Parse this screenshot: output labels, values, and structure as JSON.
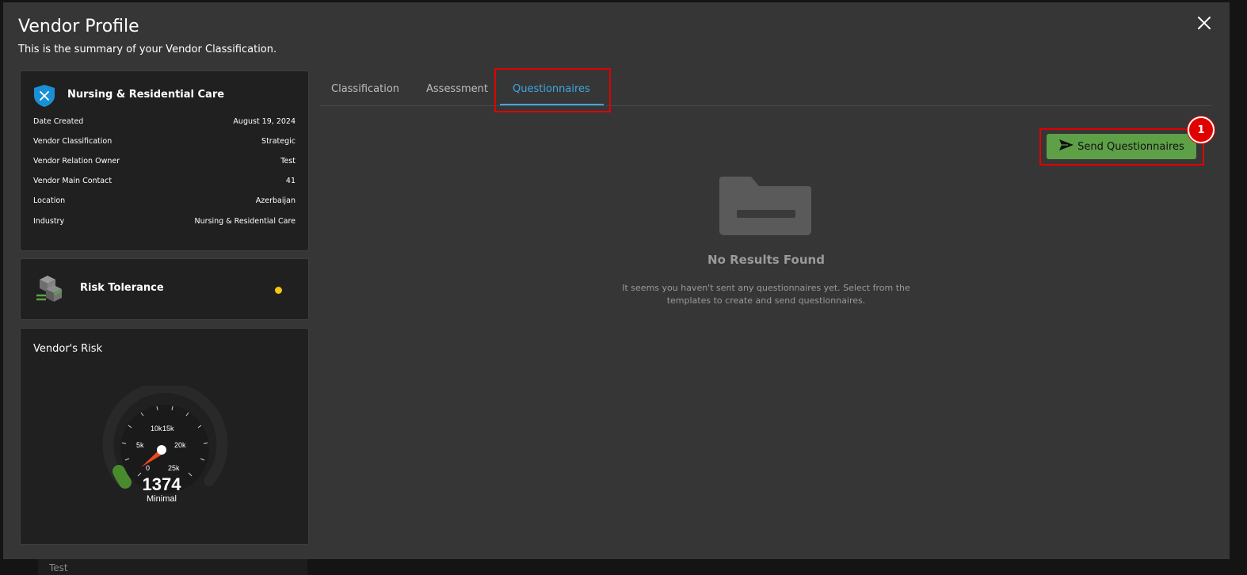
{
  "backdrop": {
    "row_text": "Test"
  },
  "modal": {
    "title": "Vendor Profile",
    "subtitle": "This is the summary of your Vendor Classification.",
    "close_icon": "close-icon"
  },
  "vendor_card": {
    "name": "Nursing & Residential Care",
    "icon": "shield-x-icon",
    "rows": [
      {
        "label": "Date Created",
        "value": "August 19, 2024"
      },
      {
        "label": "Vendor Classification",
        "value": "Strategic"
      },
      {
        "label": "Vendor Relation Owner",
        "value": "Test"
      },
      {
        "label": "Vendor Main Contact",
        "value": "41"
      },
      {
        "label": "Location",
        "value": "Azerbaijan"
      },
      {
        "label": "Industry",
        "value": "Nursing & Residential Care"
      }
    ]
  },
  "risk_tolerance": {
    "title": "Risk Tolerance",
    "icon": "cubes-icon",
    "status_color": "#f5c518"
  },
  "vendor_risk": {
    "title": "Vendor's Risk",
    "score": "1374",
    "level": "Minimal",
    "ticks": [
      "0",
      "5k",
      "10k",
      "15k",
      "20k",
      "25k"
    ],
    "level_color": "#4a8a2e"
  },
  "tabs": [
    {
      "label": "Classification",
      "active": false
    },
    {
      "label": "Assessment",
      "active": false
    },
    {
      "label": "Questionnaires",
      "active": true
    }
  ],
  "send_button": {
    "label": "Send Questionnaires",
    "icon": "send-icon"
  },
  "annotation": {
    "badge": "1"
  },
  "empty_state": {
    "icon": "folder-icon",
    "title": "No Results Found",
    "line1": "It seems you haven't sent any questionnaires yet. Select from the",
    "line2": "templates to create and send questionnaires."
  },
  "colors": {
    "accent": "#3fa7e0",
    "primary_button": "#5da047",
    "highlight": "#e10000"
  }
}
